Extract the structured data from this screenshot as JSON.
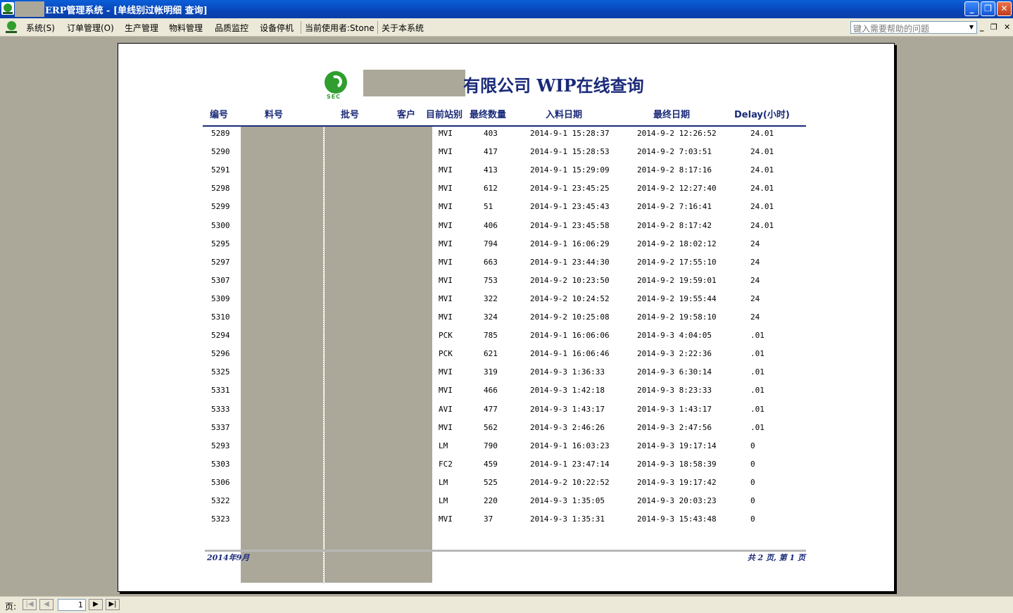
{
  "window": {
    "title": "ERP管理系统 - [单线别过帐明细 查询]",
    "buttons": {
      "minimize": "_",
      "restore": "❐",
      "close": "✕"
    }
  },
  "menu": {
    "items": [
      "系统(S)",
      "订单管理(O)",
      "生产管理",
      "物料管理",
      "品质监控",
      "设备停机",
      "当前使用者:Stone",
      "关于本系统"
    ],
    "help_placeholder": "键入需要帮助的问题"
  },
  "report": {
    "logo_text": "SEC",
    "title": "有限公司 WIP在线查询",
    "headers": [
      "编号",
      "料号",
      "批号",
      "客户",
      "目前站别",
      "最终数量",
      "入料日期",
      "最终日期",
      "Delay(小时)"
    ],
    "rows": [
      {
        "id": "5289",
        "station": "MVI",
        "qty": "403",
        "in_date": "2014-9-1 15:28:37",
        "final_date": "2014-9-2 12:26:52",
        "delay": "24.01"
      },
      {
        "id": "5290",
        "station": "MVI",
        "qty": "417",
        "in_date": "2014-9-1 15:28:53",
        "final_date": "2014-9-2 7:03:51",
        "delay": "24.01"
      },
      {
        "id": "5291",
        "station": "MVI",
        "qty": "413",
        "in_date": "2014-9-1 15:29:09",
        "final_date": "2014-9-2 8:17:16",
        "delay": "24.01"
      },
      {
        "id": "5298",
        "station": "MVI",
        "qty": "612",
        "in_date": "2014-9-1 23:45:25",
        "final_date": "2014-9-2 12:27:40",
        "delay": "24.01"
      },
      {
        "id": "5299",
        "station": "MVI",
        "qty": "51",
        "in_date": "2014-9-1 23:45:43",
        "final_date": "2014-9-2 7:16:41",
        "delay": "24.01"
      },
      {
        "id": "5300",
        "station": "MVI",
        "qty": "406",
        "in_date": "2014-9-1 23:45:58",
        "final_date": "2014-9-2 8:17:42",
        "delay": "24.01"
      },
      {
        "id": "5295",
        "station": "MVI",
        "qty": "794",
        "in_date": "2014-9-1 16:06:29",
        "final_date": "2014-9-2 18:02:12",
        "delay": "24"
      },
      {
        "id": "5297",
        "station": "MVI",
        "qty": "663",
        "in_date": "2014-9-1 23:44:30",
        "final_date": "2014-9-2 17:55:10",
        "delay": "24"
      },
      {
        "id": "5307",
        "station": "MVI",
        "qty": "753",
        "in_date": "2014-9-2 10:23:50",
        "final_date": "2014-9-2 19:59:01",
        "delay": "24"
      },
      {
        "id": "5309",
        "station": "MVI",
        "qty": "322",
        "in_date": "2014-9-2 10:24:52",
        "final_date": "2014-9-2 19:55:44",
        "delay": "24"
      },
      {
        "id": "5310",
        "station": "MVI",
        "qty": "324",
        "in_date": "2014-9-2 10:25:08",
        "final_date": "2014-9-2 19:58:10",
        "delay": "24"
      },
      {
        "id": "5294",
        "station": "PCK",
        "qty": "785",
        "in_date": "2014-9-1 16:06:06",
        "final_date": "2014-9-3 4:04:05",
        "delay": ".01"
      },
      {
        "id": "5296",
        "station": "PCK",
        "qty": "621",
        "in_date": "2014-9-1 16:06:46",
        "final_date": "2014-9-3 2:22:36",
        "delay": ".01"
      },
      {
        "id": "5325",
        "station": "MVI",
        "qty": "319",
        "in_date": "2014-9-3 1:36:33",
        "final_date": "2014-9-3 6:30:14",
        "delay": ".01"
      },
      {
        "id": "5331",
        "station": "MVI",
        "qty": "466",
        "in_date": "2014-9-3 1:42:18",
        "final_date": "2014-9-3 8:23:33",
        "delay": ".01"
      },
      {
        "id": "5333",
        "station": "AVI",
        "qty": "477",
        "in_date": "2014-9-3 1:43:17",
        "final_date": "2014-9-3 1:43:17",
        "delay": ".01"
      },
      {
        "id": "5337",
        "station": "MVI",
        "qty": "562",
        "in_date": "2014-9-3 2:46:26",
        "final_date": "2014-9-3 2:47:56",
        "delay": ".01"
      },
      {
        "id": "5293",
        "station": "LM",
        "qty": "790",
        "in_date": "2014-9-1 16:03:23",
        "final_date": "2014-9-3 19:17:14",
        "delay": "0"
      },
      {
        "id": "5303",
        "station": "FC2",
        "qty": "459",
        "in_date": "2014-9-1 23:47:14",
        "final_date": "2014-9-3 18:58:39",
        "delay": "0"
      },
      {
        "id": "5306",
        "station": "LM",
        "qty": "525",
        "in_date": "2014-9-2 10:22:52",
        "final_date": "2014-9-3 19:17:42",
        "delay": "0"
      },
      {
        "id": "5322",
        "station": "LM",
        "qty": "220",
        "in_date": "2014-9-3 1:35:05",
        "final_date": "2014-9-3 20:03:23",
        "delay": "0"
      },
      {
        "id": "5323",
        "station": "MVI",
        "qty": "37",
        "in_date": "2014-9-3 1:35:31",
        "final_date": "2014-9-3 15:43:48",
        "delay": "0"
      }
    ],
    "footer_left": "2014年9月",
    "footer_right": "共 2 页, 第 1 页"
  },
  "pager": {
    "label": "页:",
    "current_page": "1",
    "first": "|◀",
    "prev": "◀",
    "next": "▶",
    "last": "▶|"
  },
  "colors": {
    "title_bar": "#0a5fd8",
    "report_text": "#1a2a78",
    "logo_green": "#2f9e2f",
    "redaction": "#aca899"
  }
}
